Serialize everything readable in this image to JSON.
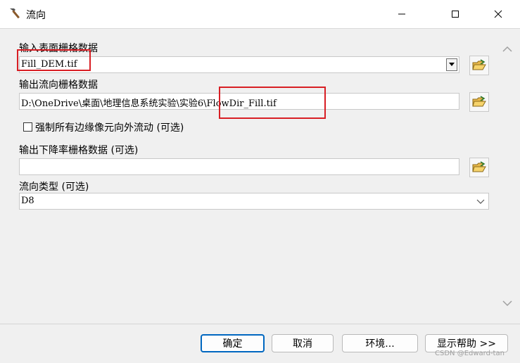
{
  "window": {
    "title": "流向",
    "icons": {
      "app": "hammer-icon",
      "minimize": "minimize-icon",
      "maximize": "maximize-icon",
      "close": "close-icon"
    }
  },
  "form": {
    "input_raster": {
      "label": "输入表面栅格数据",
      "value": "Fill_DEM.tif"
    },
    "output_flow": {
      "label": "输出流向栅格数据",
      "value": "D:\\OneDrive\\桌面\\地理信息系统实验\\实验6\\FlowDir_Fill.tif"
    },
    "force_edge": {
      "label": "强制所有边缘像元向外流动 (可选)",
      "checked": false
    },
    "output_drop": {
      "label": "输出下降率栅格数据 (可选)",
      "value": ""
    },
    "flow_type": {
      "label": "流向类型 (可选)",
      "value": "D8"
    }
  },
  "buttons": {
    "ok": "确定",
    "cancel": "取消",
    "env": "环境...",
    "help": "显示帮助 >>"
  },
  "watermark": "CSDN @Edward-tan",
  "colors": {
    "highlight": "#d81e24",
    "primary_border": "#0067c0"
  }
}
